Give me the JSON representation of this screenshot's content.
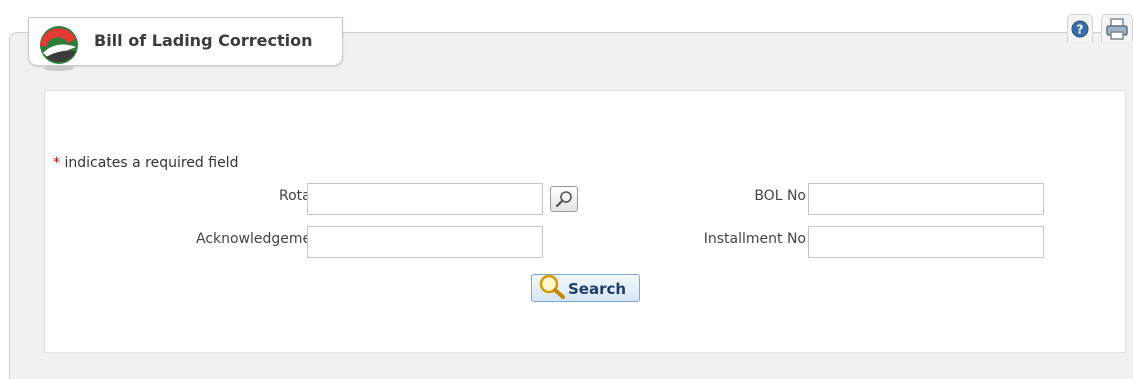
{
  "header": {
    "title": "Bill of Lading Correction"
  },
  "toolbar": {
    "help_icon": "help-icon",
    "print_icon": "print-icon"
  },
  "form": {
    "required_note": "indicates a required field",
    "required_marker": "*",
    "rotation_label": "Rotation",
    "rotation_value": "",
    "acknowledgement_label": "Acknowledgement No",
    "acknowledgement_value": "",
    "bol_label": "BOL No",
    "bol_value": "",
    "installment_label": "Installment No",
    "installment_value": "",
    "search_label": "Search"
  },
  "colors": {
    "required": "#b30000",
    "panel": "#f1f1f1",
    "button": "#d5e6f5"
  }
}
